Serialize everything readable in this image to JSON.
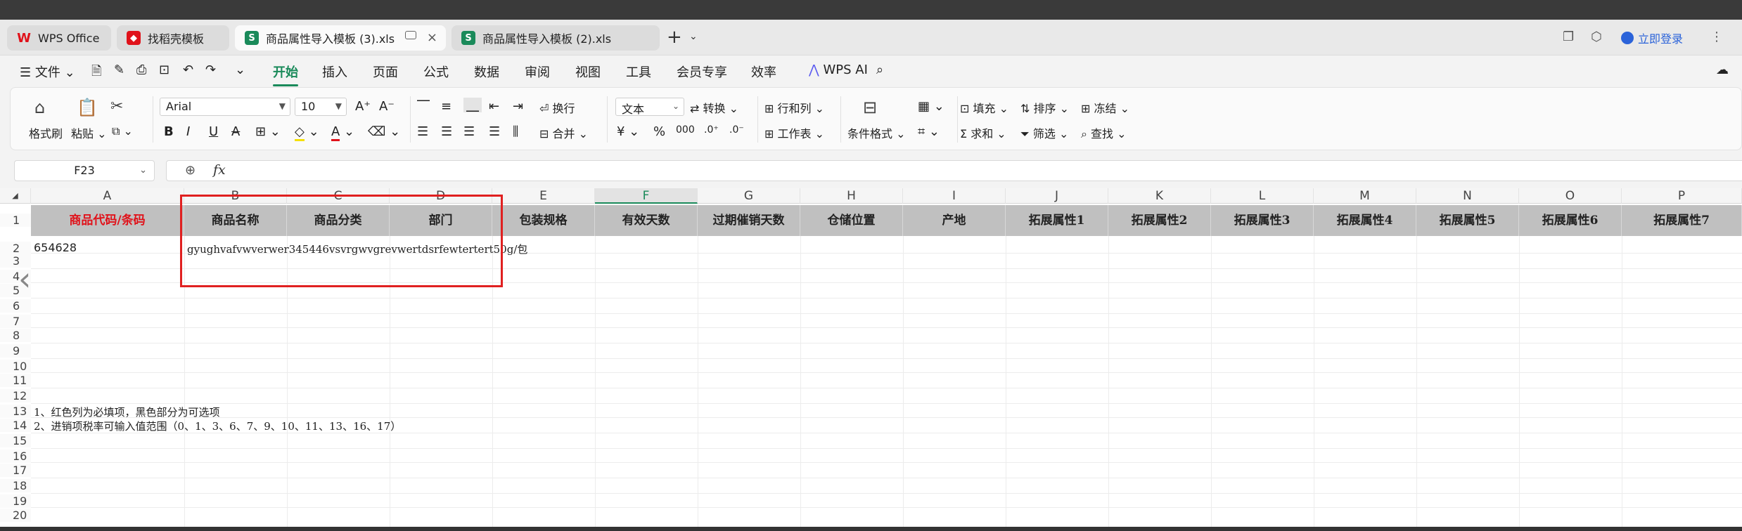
{
  "tabs": [
    {
      "label": "WPS Office",
      "icon": "wps-logo-icon",
      "color": "#e0121a"
    },
    {
      "label": "找稻壳模板",
      "icon": "docer-icon",
      "color": "#e0121a"
    },
    {
      "label": "商品属性导入模板 (3).xls",
      "icon": "spreadsheet-icon",
      "color": "#1a8a5a"
    },
    {
      "label": "商品属性导入模板 (2).xls",
      "icon": "spreadsheet-icon",
      "color": "#1a8a5a"
    }
  ],
  "login_label": "立即登录",
  "menu": {
    "file": "文件",
    "items": [
      "开始",
      "插入",
      "页面",
      "公式",
      "数据",
      "审阅",
      "视图",
      "工具",
      "会员专享",
      "效率"
    ],
    "active": "开始",
    "ai": "WPS AI"
  },
  "ribbon": {
    "format_painter": "格式刷",
    "paste": "粘贴",
    "font": "Arial",
    "size": "10",
    "wrap": "换行",
    "merge": "合并",
    "number_format": "文本",
    "convert": "转换",
    "rows_cols": "行和列",
    "worksheet": "工作表",
    "cond_format": "条件格式",
    "fill": "填充",
    "sort": "排序",
    "freeze": "冻结",
    "sum": "求和",
    "filter": "筛选",
    "find": "查找",
    "bold": "B",
    "italic": "I",
    "underline": "U",
    "strike": "A"
  },
  "formula_bar": {
    "cell_ref": "F23",
    "fx": "fx",
    "value": ""
  },
  "sheet": {
    "columns": [
      "A",
      "B",
      "C",
      "D",
      "E",
      "F",
      "G",
      "H",
      "I",
      "J",
      "K",
      "L",
      "M",
      "N",
      "O",
      "P"
    ],
    "active_column": "F",
    "headers": [
      "商品代码/条码",
      "商品名称",
      "商品分类",
      "部门",
      "包装规格",
      "有效天数",
      "过期催销天数",
      "仓储位置",
      "产地",
      "拓展属性1",
      "拓展属性2",
      "拓展属性3",
      "拓展属性4",
      "拓展属性5",
      "拓展属性6",
      "拓展属性7"
    ],
    "required_header_color": "#e0121a",
    "rows": [
      "1",
      "2",
      "3",
      "4",
      "5",
      "6",
      "7",
      "8",
      "9",
      "10",
      "11",
      "12",
      "13",
      "14",
      "15",
      "16",
      "17",
      "18",
      "19",
      "20"
    ],
    "a2": "654628",
    "b2": "gyughvafvwverwer345446vsvrgwvgrevwertdsrfewtertert50g/包",
    "note1": "1、红色列为必填项，黑色部分为可选项",
    "note2": "2、进销项税率可输入值范围（0、1、3、6、7、9、10、11、13、16、17）"
  }
}
